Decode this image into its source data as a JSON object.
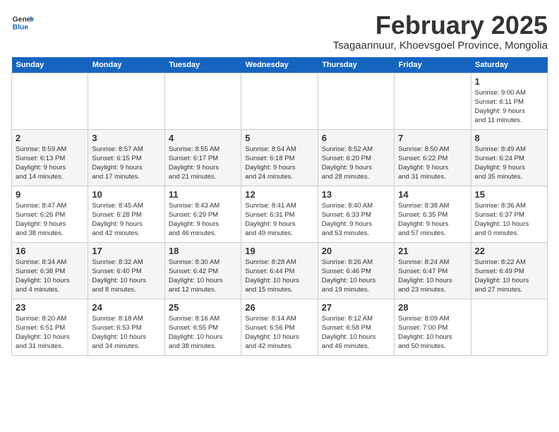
{
  "header": {
    "logo_line1": "General",
    "logo_line2": "Blue",
    "month_title": "February 2025",
    "subtitle": "Tsagaannuur, Khoevsgoel Province, Mongolia"
  },
  "days_of_week": [
    "Sunday",
    "Monday",
    "Tuesday",
    "Wednesday",
    "Thursday",
    "Friday",
    "Saturday"
  ],
  "weeks": [
    [
      {
        "day": "",
        "info": ""
      },
      {
        "day": "",
        "info": ""
      },
      {
        "day": "",
        "info": ""
      },
      {
        "day": "",
        "info": ""
      },
      {
        "day": "",
        "info": ""
      },
      {
        "day": "",
        "info": ""
      },
      {
        "day": "1",
        "info": "Sunrise: 9:00 AM\nSunset: 6:11 PM\nDaylight: 9 hours\nand 11 minutes."
      }
    ],
    [
      {
        "day": "2",
        "info": "Sunrise: 8:59 AM\nSunset: 6:13 PM\nDaylight: 9 hours\nand 14 minutes."
      },
      {
        "day": "3",
        "info": "Sunrise: 8:57 AM\nSunset: 6:15 PM\nDaylight: 9 hours\nand 17 minutes."
      },
      {
        "day": "4",
        "info": "Sunrise: 8:55 AM\nSunset: 6:17 PM\nDaylight: 9 hours\nand 21 minutes."
      },
      {
        "day": "5",
        "info": "Sunrise: 8:54 AM\nSunset: 6:18 PM\nDaylight: 9 hours\nand 24 minutes."
      },
      {
        "day": "6",
        "info": "Sunrise: 8:52 AM\nSunset: 6:20 PM\nDaylight: 9 hours\nand 28 minutes."
      },
      {
        "day": "7",
        "info": "Sunrise: 8:50 AM\nSunset: 6:22 PM\nDaylight: 9 hours\nand 31 minutes."
      },
      {
        "day": "8",
        "info": "Sunrise: 8:49 AM\nSunset: 6:24 PM\nDaylight: 9 hours\nand 35 minutes."
      }
    ],
    [
      {
        "day": "9",
        "info": "Sunrise: 8:47 AM\nSunset: 6:26 PM\nDaylight: 9 hours\nand 38 minutes."
      },
      {
        "day": "10",
        "info": "Sunrise: 8:45 AM\nSunset: 6:28 PM\nDaylight: 9 hours\nand 42 minutes."
      },
      {
        "day": "11",
        "info": "Sunrise: 8:43 AM\nSunset: 6:29 PM\nDaylight: 9 hours\nand 46 minutes."
      },
      {
        "day": "12",
        "info": "Sunrise: 8:41 AM\nSunset: 6:31 PM\nDaylight: 9 hours\nand 49 minutes."
      },
      {
        "day": "13",
        "info": "Sunrise: 8:40 AM\nSunset: 6:33 PM\nDaylight: 9 hours\nand 53 minutes."
      },
      {
        "day": "14",
        "info": "Sunrise: 8:38 AM\nSunset: 6:35 PM\nDaylight: 9 hours\nand 57 minutes."
      },
      {
        "day": "15",
        "info": "Sunrise: 8:36 AM\nSunset: 6:37 PM\nDaylight: 10 hours\nand 0 minutes."
      }
    ],
    [
      {
        "day": "16",
        "info": "Sunrise: 8:34 AM\nSunset: 6:38 PM\nDaylight: 10 hours\nand 4 minutes."
      },
      {
        "day": "17",
        "info": "Sunrise: 8:32 AM\nSunset: 6:40 PM\nDaylight: 10 hours\nand 8 minutes."
      },
      {
        "day": "18",
        "info": "Sunrise: 8:30 AM\nSunset: 6:42 PM\nDaylight: 10 hours\nand 12 minutes."
      },
      {
        "day": "19",
        "info": "Sunrise: 8:28 AM\nSunset: 6:44 PM\nDaylight: 10 hours\nand 15 minutes."
      },
      {
        "day": "20",
        "info": "Sunrise: 8:26 AM\nSunset: 6:46 PM\nDaylight: 10 hours\nand 19 minutes."
      },
      {
        "day": "21",
        "info": "Sunrise: 8:24 AM\nSunset: 6:47 PM\nDaylight: 10 hours\nand 23 minutes."
      },
      {
        "day": "22",
        "info": "Sunrise: 8:22 AM\nSunset: 6:49 PM\nDaylight: 10 hours\nand 27 minutes."
      }
    ],
    [
      {
        "day": "23",
        "info": "Sunrise: 8:20 AM\nSunset: 6:51 PM\nDaylight: 10 hours\nand 31 minutes."
      },
      {
        "day": "24",
        "info": "Sunrise: 8:18 AM\nSunset: 6:53 PM\nDaylight: 10 hours\nand 34 minutes."
      },
      {
        "day": "25",
        "info": "Sunrise: 8:16 AM\nSunset: 6:55 PM\nDaylight: 10 hours\nand 38 minutes."
      },
      {
        "day": "26",
        "info": "Sunrise: 8:14 AM\nSunset: 6:56 PM\nDaylight: 10 hours\nand 42 minutes."
      },
      {
        "day": "27",
        "info": "Sunrise: 8:12 AM\nSunset: 6:58 PM\nDaylight: 10 hours\nand 46 minutes."
      },
      {
        "day": "28",
        "info": "Sunrise: 8:09 AM\nSunset: 7:00 PM\nDaylight: 10 hours\nand 50 minutes."
      },
      {
        "day": "",
        "info": ""
      }
    ]
  ]
}
